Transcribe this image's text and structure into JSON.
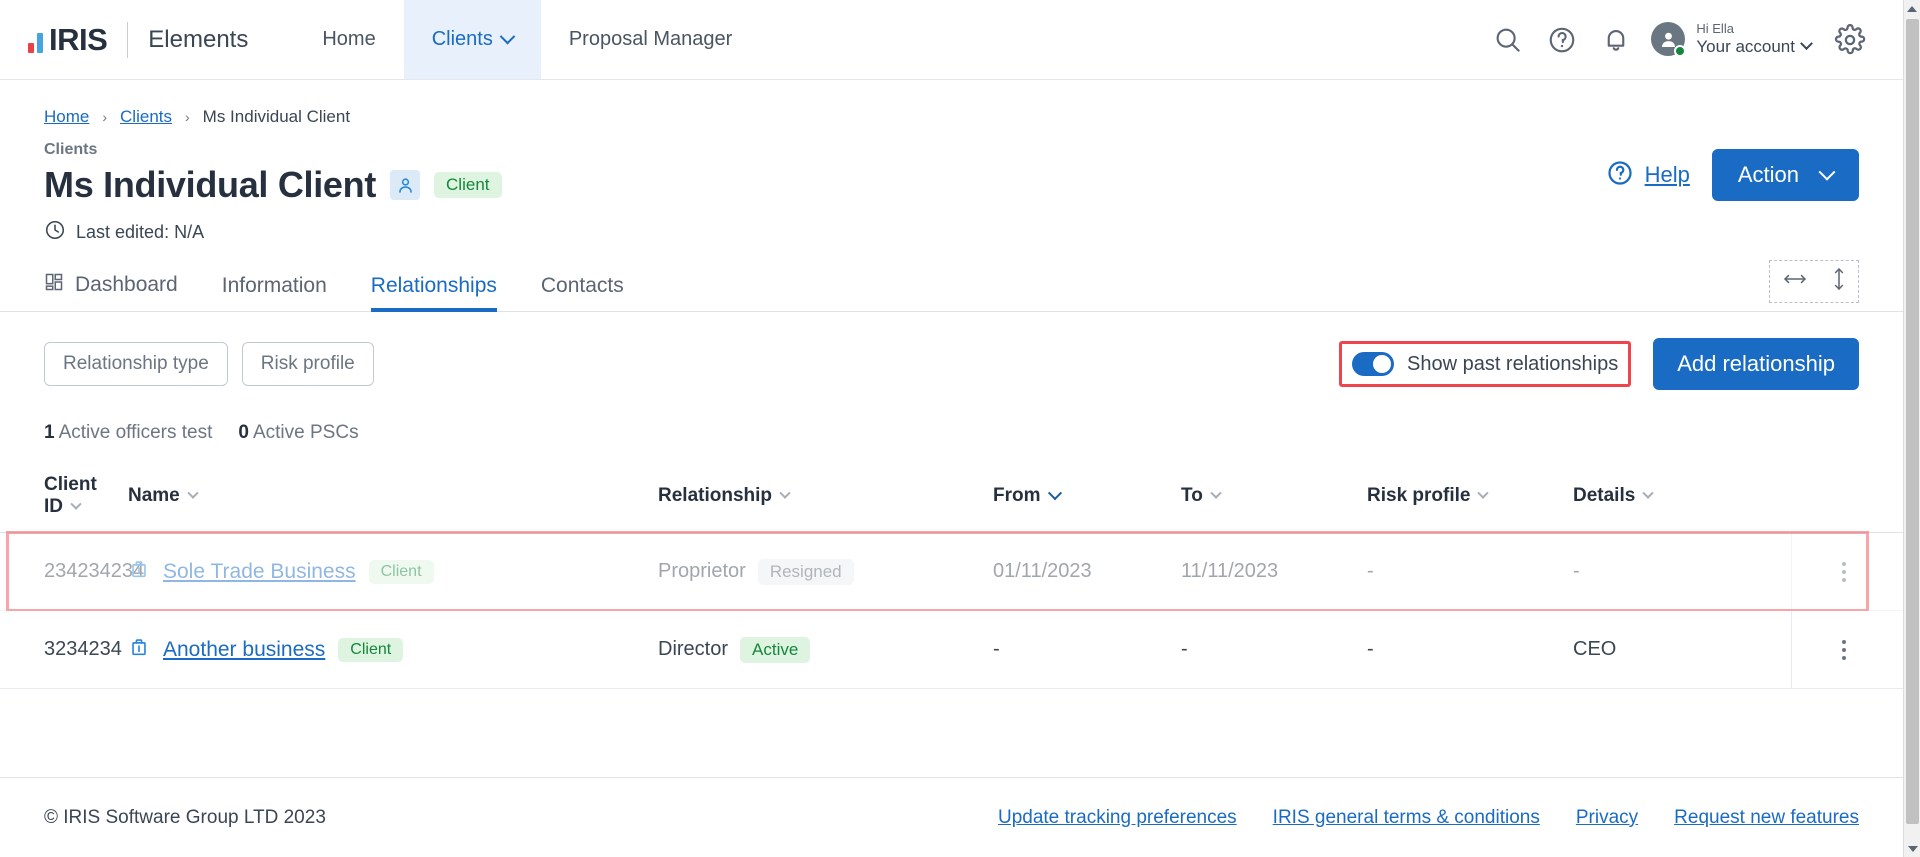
{
  "nav": {
    "logo_text": "IRIS",
    "product": "Elements",
    "links": [
      {
        "label": "Home",
        "active": false,
        "caret": false
      },
      {
        "label": "Clients",
        "active": true,
        "caret": true
      },
      {
        "label": "Proposal Manager",
        "active": false,
        "caret": false
      }
    ],
    "icons": {
      "search": "search-icon",
      "help": "help-circle-icon",
      "bell": "bell-icon",
      "gear": "gear-icon"
    },
    "account": {
      "greeting": "Hi Ella",
      "label": "Your account"
    }
  },
  "breadcrumb": {
    "items": [
      "Home",
      "Clients",
      "Ms Individual Client"
    ],
    "separator": "›"
  },
  "header": {
    "eyebrow": "Clients",
    "title": "Ms Individual Client",
    "badge": "Client",
    "last_edited": "Last edited: N/A",
    "help_label": "Help",
    "action_label": "Action"
  },
  "tabs": [
    {
      "label": "Dashboard",
      "active": false,
      "icon": "grid-icon"
    },
    {
      "label": "Information",
      "active": false
    },
    {
      "label": "Relationships",
      "active": true
    },
    {
      "label": "Contacts",
      "active": false
    }
  ],
  "filters": {
    "buttons": [
      "Relationship type",
      "Risk profile"
    ],
    "toggle": {
      "label": "Show past relationships",
      "on": true
    },
    "add_button": "Add relationship"
  },
  "counts": [
    {
      "value": "1",
      "label": "Active officers test"
    },
    {
      "value": "0",
      "label": "Active PSCs"
    }
  ],
  "table": {
    "columns": [
      {
        "label": "Client ID",
        "sorted": false
      },
      {
        "label": "Name",
        "sorted": false
      },
      {
        "label": "Relationship",
        "sorted": false
      },
      {
        "label": "From",
        "sorted": true
      },
      {
        "label": "To",
        "sorted": false
      },
      {
        "label": "Risk profile",
        "sorted": false
      },
      {
        "label": "Details",
        "sorted": false
      }
    ],
    "rows": [
      {
        "client_id": "234234234",
        "name": "Sole Trade Business",
        "name_badge": "Client",
        "relationship": "Proprietor",
        "status": "Resigned",
        "status_kind": "grey",
        "from": "01/11/2023",
        "to": "11/11/2023",
        "risk_profile": "-",
        "details": "-",
        "muted": true,
        "highlighted": true
      },
      {
        "client_id": "3234234",
        "name": "Another business",
        "name_badge": "Client",
        "relationship": "Director",
        "status": "Active",
        "status_kind": "green",
        "from": "-",
        "to": "-",
        "risk_profile": "-",
        "details": "CEO",
        "muted": false,
        "highlighted": false
      }
    ]
  },
  "footer": {
    "copyright": "© IRIS Software Group LTD 2023",
    "links": [
      "Update tracking preferences",
      "IRIS general terms & conditions",
      "Privacy",
      "Request new features"
    ]
  },
  "colors": {
    "accent": "#1a6bc4",
    "annotation": "#f0444c",
    "success": "#13873b",
    "logo_red": "#e8414a",
    "logo_blue": "#46a4e0"
  }
}
